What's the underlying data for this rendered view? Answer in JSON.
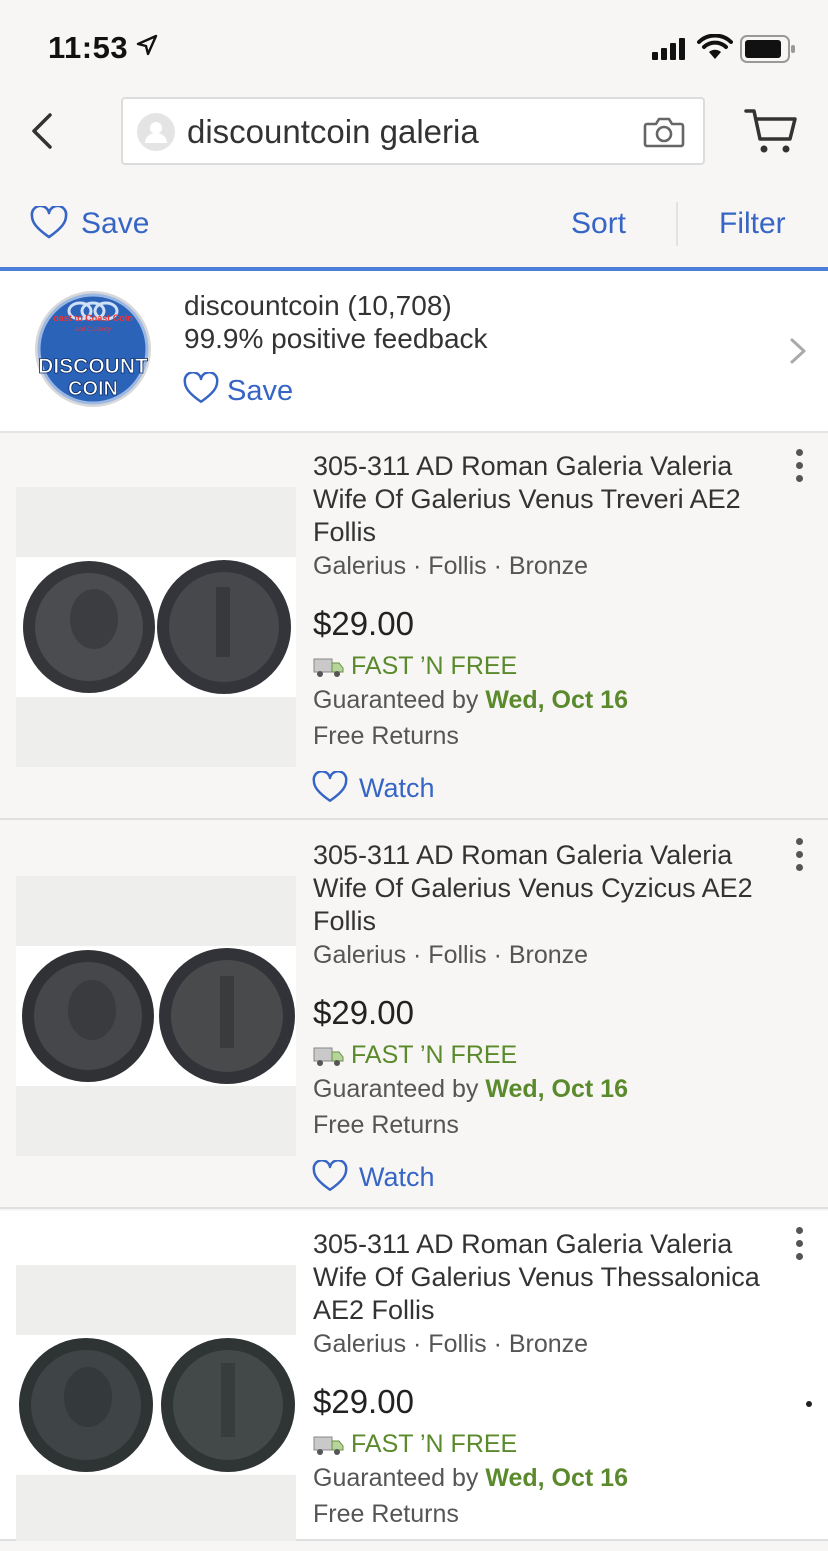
{
  "status": {
    "time": "11:53"
  },
  "search": {
    "query": "discountcoin galeria"
  },
  "toolbar": {
    "save_label": "Save",
    "sort_label": "Sort",
    "filter_label": "Filter"
  },
  "seller": {
    "name_line": "discountcoin (10,708)",
    "feedback": "99.9% positive feedback",
    "save_label": "Save",
    "logo_top": "oast to Coast Coin",
    "logo_sub": "and Currency",
    "logo_main1": "DISCOUNT",
    "logo_main2": "COIN"
  },
  "items": [
    {
      "title": "305-311 AD Roman Galeria Valeria Wife Of Galerius Venus Treveri AE2 Follis",
      "meta": "Galerius · Follis · Bronze",
      "price": "$29.00",
      "shipping": "FAST ’N FREE",
      "guaranteed_prefix": "Guaranteed by ",
      "guaranteed_date": "Wed, Oct 16",
      "returns": "Free Returns",
      "watch": "Watch"
    },
    {
      "title": "305-311 AD Roman Galeria Valeria Wife Of Galerius Venus Cyzicus AE2 Follis",
      "meta": "Galerius · Follis · Bronze",
      "price": "$29.00",
      "shipping": "FAST ’N FREE",
      "guaranteed_prefix": "Guaranteed by ",
      "guaranteed_date": "Wed, Oct 16",
      "returns": "Free Returns",
      "watch": "Watch"
    },
    {
      "title": "305-311 AD Roman Galeria Valeria Wife Of Galerius Venus Thessalonica AE2 Follis",
      "meta": "Galerius · Follis · Bronze",
      "price": "$29.00",
      "shipping": "FAST ’N FREE",
      "guaranteed_prefix": "Guaranteed by ",
      "guaranteed_date": "Wed, Oct 16",
      "returns": "Free Returns"
    }
  ],
  "colors": {
    "link_blue": "#3665c5",
    "ship_green": "#5a8a2c",
    "accent_line": "#4b7fd9"
  }
}
